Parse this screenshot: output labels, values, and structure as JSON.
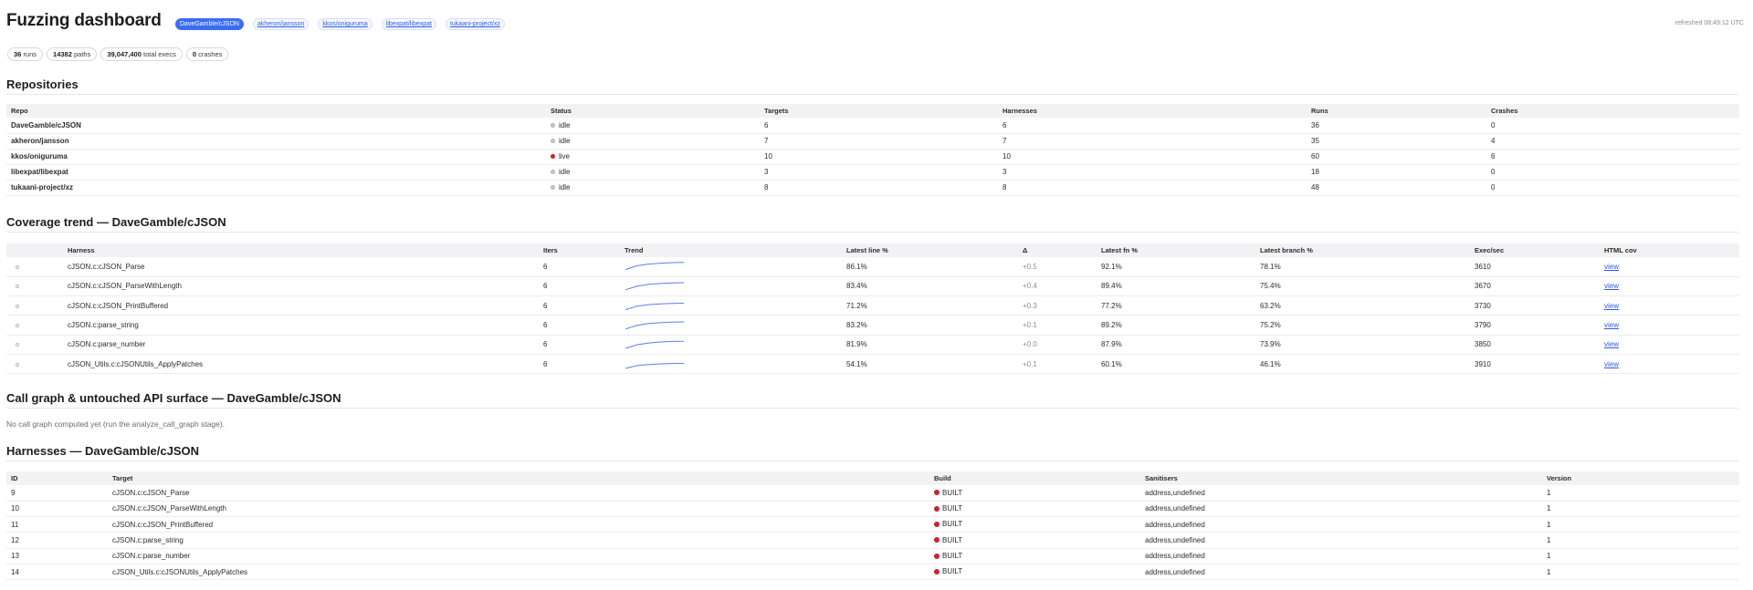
{
  "header": {
    "title": "Fuzzing dashboard",
    "repo_tabs": [
      "DaveGamble/cJSON",
      "akheron/jansson",
      "kkos/oniguruma",
      "libexpat/libexpat",
      "tukaani-project/xz"
    ],
    "active_repo": "DaveGamble/cJSON",
    "refreshed": "refreshed 08:49:12 UTC"
  },
  "stats": {
    "runs_value": "36",
    "runs_label": "runs",
    "paths_value": "14382",
    "paths_label": "paths",
    "execs_value": "39,047,400",
    "execs_label": "total execs",
    "crashes_value": "0",
    "crashes_label": "crashes"
  },
  "repositories": {
    "title": "Repositories",
    "columns": [
      "Repo",
      "Status",
      "Targets",
      "Harnesses",
      "Runs",
      "Crashes"
    ],
    "rows": [
      {
        "repo": "DaveGamble/cJSON",
        "status": "idle",
        "targets": "6",
        "harnesses": "6",
        "runs": "36",
        "crashes": "0"
      },
      {
        "repo": "akheron/jansson",
        "status": "idle",
        "targets": "7",
        "harnesses": "7",
        "runs": "35",
        "crashes": "4"
      },
      {
        "repo": "kkos/oniguruma",
        "status": "live",
        "targets": "10",
        "harnesses": "10",
        "runs": "60",
        "crashes": "6"
      },
      {
        "repo": "libexpat/libexpat",
        "status": "idle",
        "targets": "3",
        "harnesses": "3",
        "runs": "18",
        "crashes": "0"
      },
      {
        "repo": "tukaani-project/xz",
        "status": "idle",
        "targets": "8",
        "harnesses": "8",
        "runs": "48",
        "crashes": "0"
      }
    ]
  },
  "coverage": {
    "title": "Coverage trend — DaveGamble/cJSON",
    "columns": [
      "",
      "Harness",
      "Iters",
      "Trend",
      "Latest line %",
      "Δ",
      "Latest fn %",
      "Latest branch %",
      "Exec/sec",
      "HTML cov"
    ],
    "trend_color": "#5b7fe8",
    "rows": [
      {
        "harness": "cJSON.c:cJSON_Parse",
        "iters": "6",
        "trend": [
          20,
          55,
          70,
          78,
          83,
          86.1
        ],
        "line": "86.1%",
        "delta": "+0.5",
        "fn": "92.1%",
        "branch": "78.1%",
        "exec": "3610",
        "link": "view"
      },
      {
        "harness": "cJSON.c:cJSON_ParseWithLength",
        "iters": "6",
        "trend": [
          18,
          52,
          68,
          76,
          81,
          83.4
        ],
        "line": "83.4%",
        "delta": "+0.4",
        "fn": "89.4%",
        "branch": "75.4%",
        "exec": "3670",
        "link": "view"
      },
      {
        "harness": "cJSON.c:cJSON_PrintBuffered",
        "iters": "6",
        "trend": [
          12,
          44,
          58,
          65,
          69,
          71.2
        ],
        "line": "71.2%",
        "delta": "+0.3",
        "fn": "77.2%",
        "branch": "63.2%",
        "exec": "3730",
        "link": "view"
      },
      {
        "harness": "cJSON.c:parse_string",
        "iters": "6",
        "trend": [
          18,
          52,
          68,
          76,
          81,
          83.2
        ],
        "line": "83.2%",
        "delta": "+0.1",
        "fn": "89.2%",
        "branch": "75.2%",
        "exec": "3790",
        "link": "view"
      },
      {
        "harness": "cJSON.c:parse_number",
        "iters": "6",
        "trend": [
          17,
          50,
          66,
          75,
          80,
          81.9
        ],
        "line": "81.9%",
        "delta": "+0.0",
        "fn": "87.9%",
        "branch": "73.9%",
        "exec": "3850",
        "link": "view"
      },
      {
        "harness": "cJSON_Utils.c:cJSONUtils_ApplyPatches",
        "iters": "6",
        "trend": [
          8,
          34,
          44,
          50,
          53,
          54.1
        ],
        "line": "54.1%",
        "delta": "+0.1",
        "fn": "60.1%",
        "branch": "46.1%",
        "exec": "3910",
        "link": "view"
      }
    ]
  },
  "callgraph": {
    "title": "Call graph & untouched API surface — DaveGamble/cJSON",
    "note": "No call graph computed yet (run the analyze_call_graph stage)."
  },
  "harnesses": {
    "title": "Harnesses — DaveGamble/cJSON",
    "columns": [
      "ID",
      "Target",
      "Build",
      "Sanitisers",
      "Version"
    ],
    "rows": [
      {
        "id": "9",
        "target": "cJSON.c:cJSON_Parse",
        "build": "BUILT",
        "sanitisers": "address,undefined",
        "version": "1"
      },
      {
        "id": "10",
        "target": "cJSON.c:cJSON_ParseWithLength",
        "build": "BUILT",
        "sanitisers": "address,undefined",
        "version": "1"
      },
      {
        "id": "11",
        "target": "cJSON.c:cJSON_PrintBuffered",
        "build": "BUILT",
        "sanitisers": "address,undefined",
        "version": "1"
      },
      {
        "id": "12",
        "target": "cJSON.c:parse_string",
        "build": "BUILT",
        "sanitisers": "address,undefined",
        "version": "1"
      },
      {
        "id": "13",
        "target": "cJSON.c:parse_number",
        "build": "BUILT",
        "sanitisers": "address,undefined",
        "version": "1"
      },
      {
        "id": "14",
        "target": "cJSON_Utils.c:cJSONUtils_ApplyPatches",
        "build": "BUILT",
        "sanitisers": "address,undefined",
        "version": "1"
      }
    ]
  }
}
